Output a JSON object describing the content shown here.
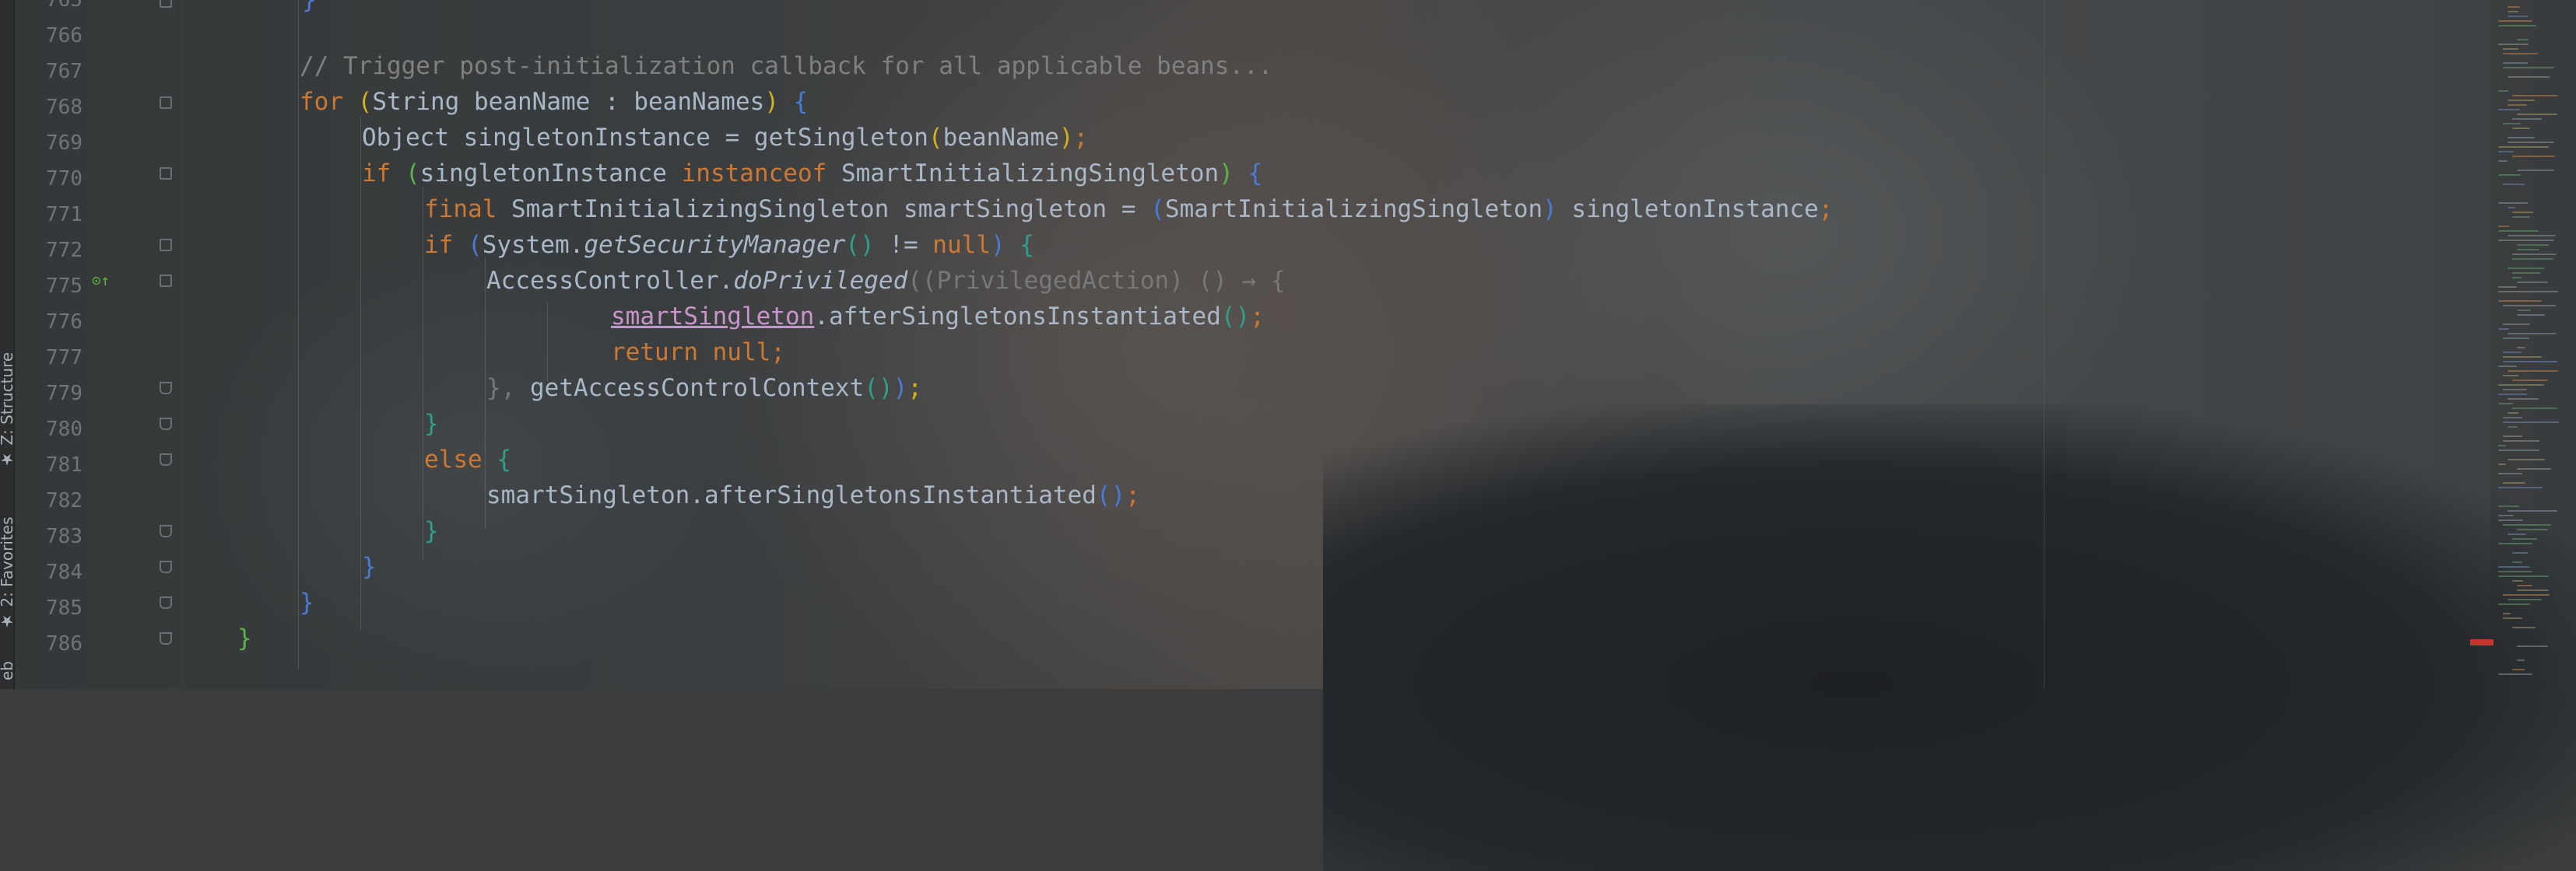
{
  "editor": {
    "language": "java",
    "lines": [
      {
        "num": "765",
        "code": "}"
      },
      {
        "num": "766",
        "code": "// Trigger post-initialization callback for all applicable beans..."
      },
      {
        "num": "767",
        "code": "for (String beanName : beanNames) {"
      },
      {
        "num": "768",
        "code": "Object singletonInstance = getSingleton(beanName);"
      },
      {
        "num": "769",
        "code": "if (singletonInstance instanceof SmartInitializingSingleton) {"
      },
      {
        "num": "770",
        "code": "final SmartInitializingSingleton smartSingleton = (SmartInitializingSingleton) singletonInstance;"
      },
      {
        "num": "771",
        "code": "if (System.getSecurityManager() != null) {"
      },
      {
        "num": "772",
        "code": "AccessController.doPrivileged((PrivilegedAction) () → {"
      },
      {
        "num": "775",
        "code": "smartSingleton.afterSingletonsInstantiated();"
      },
      {
        "num": "776",
        "code": "return null;"
      },
      {
        "num": "777",
        "code": "}, getAccessControlContext());"
      },
      {
        "num": "779",
        "code": "}"
      },
      {
        "num": "780",
        "code": "else {"
      },
      {
        "num": "781",
        "code": "smartSingleton.afterSingletonsInstantiated();"
      },
      {
        "num": "782",
        "code": "}"
      },
      {
        "num": "783",
        "code": "}"
      },
      {
        "num": "784",
        "code": "}"
      },
      {
        "num": "785",
        "code": "}"
      },
      {
        "num": "786",
        "code": ""
      }
    ],
    "line_numbers": [
      "765",
      "766",
      "767",
      "768",
      "769",
      "770",
      "771",
      "772",
      "775",
      "776",
      "777",
      "779",
      "780",
      "781",
      "782",
      "783",
      "784",
      "785",
      "786"
    ]
  },
  "tokens": {
    "comment": "// Trigger post-initialization callback for all applicable beans...",
    "kw_for": "for",
    "kw_if": "if",
    "kw_final": "final",
    "kw_instanceof": "instanceof",
    "kw_null": "null",
    "kw_return": "return null;",
    "kw_else": "else",
    "string_type": "String",
    "var_beanName": "beanName",
    "colon": ":",
    "var_beanNames": "beanNames",
    "object_decl": "Object singletonInstance = getSingleton",
    "arg_beanName": "beanName",
    "semicolon": ";",
    "singletonInstance": "singletonInstance",
    "smart_type": "SmartInitializingSingleton",
    "smart_decl": "SmartInitializingSingleton smartSingleton =",
    "cast_type": "SmartInitializingSingleton",
    "cast_target": "singletonInstance",
    "system": "System.",
    "getSecurityManager": "getSecurityManager",
    "not_equal": "!=",
    "access_controller": "AccessController.",
    "doPrivileged": "doPrivileged",
    "privileged_action": "PrivilegedAction",
    "lambda": "() → {",
    "smartSingleton_field": "smartSingleton",
    "after_call": ".afterSingletonsInstantiated",
    "close_lambda": "},",
    "get_acc": "getAccessControlContext",
    "smartSingleton_call": "smartSingleton.afterSingletonsInstantiated"
  },
  "tool_windows": {
    "structure": "★ Z: Structure",
    "favorites": "★ 2: Favorites",
    "edge": "eb"
  },
  "colors": {
    "keyword": "#cc7832",
    "comment": "#808080",
    "text": "#a9b7c6",
    "field": "#c995c9",
    "brace_teal": "#2f9f8b",
    "brace_green": "#59b54a",
    "brace_blue": "#4a7bd4",
    "brace_yellow": "#d4b11e",
    "error_marker": "#c3352d"
  },
  "icons": {
    "gutter_implementation": "override-implement-icon"
  }
}
